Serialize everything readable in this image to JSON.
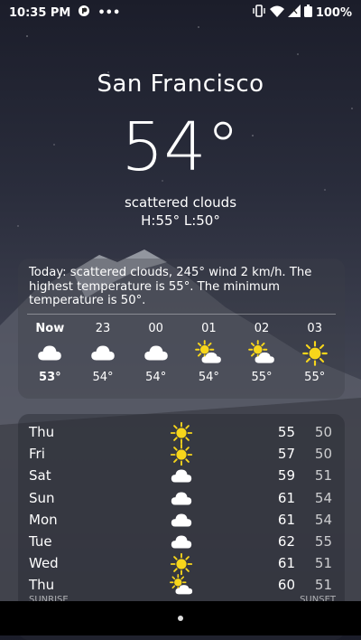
{
  "status_bar": {
    "time": "10:35 PM",
    "more": "•••",
    "battery": "100%",
    "icons": [
      "app-icon",
      "vibrate-icon",
      "wifi-icon",
      "signal-icon",
      "battery-icon"
    ]
  },
  "location": {
    "city": "San Francisco"
  },
  "current": {
    "temperature": "54°",
    "description": "scattered clouds",
    "hilo": "H:55° L:50°"
  },
  "today": {
    "summary": "Today: scattered clouds, 245° wind 2 km/h. The highest temperature is 55°. The minimum temperature is 50°."
  },
  "hourly": [
    {
      "time": "Now",
      "icon": "cloud",
      "temp": "53°"
    },
    {
      "time": "23",
      "icon": "cloud",
      "temp": "54°"
    },
    {
      "time": "00",
      "icon": "cloud",
      "temp": "54°"
    },
    {
      "time": "01",
      "icon": "sun-cloud",
      "temp": "54°"
    },
    {
      "time": "02",
      "icon": "sun-cloud",
      "temp": "55°"
    },
    {
      "time": "03",
      "icon": "sun",
      "temp": "55°"
    }
  ],
  "daily": [
    {
      "day": "Thu",
      "icon": "sun",
      "high": "55",
      "low": "50"
    },
    {
      "day": "Fri",
      "icon": "sun",
      "high": "57",
      "low": "50"
    },
    {
      "day": "Sat",
      "icon": "cloud",
      "high": "59",
      "low": "51"
    },
    {
      "day": "Sun",
      "icon": "cloud",
      "high": "61",
      "low": "54"
    },
    {
      "day": "Mon",
      "icon": "cloud",
      "high": "61",
      "low": "54"
    },
    {
      "day": "Tue",
      "icon": "cloud",
      "high": "62",
      "low": "55"
    },
    {
      "day": "Wed",
      "icon": "sun",
      "high": "61",
      "low": "51"
    },
    {
      "day": "Thu",
      "icon": "sun-cloud",
      "high": "60",
      "low": "51"
    }
  ],
  "sun_times": {
    "sunrise_label": "SUNRISE",
    "sunset_label": "SUNSET"
  },
  "colors": {
    "sun": "#f7d61b",
    "cloud": "#ffffff"
  }
}
